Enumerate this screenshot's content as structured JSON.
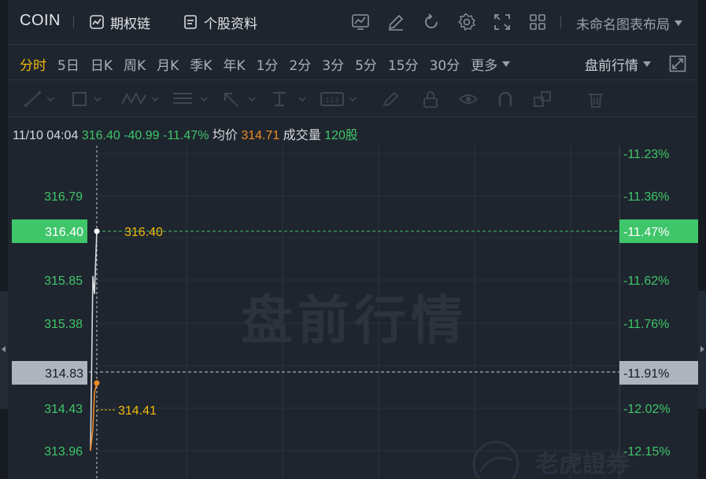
{
  "header": {
    "ticker": "COIN",
    "options_chain_label": "期权链",
    "profile_label": "个股资料",
    "layout_label": "未命名图表布局",
    "icons": [
      "indicator-icon",
      "edit-icon",
      "refresh-icon",
      "settings-icon",
      "fullscreen-icon",
      "grid-icon"
    ]
  },
  "periods": {
    "items": [
      "分时",
      "5日",
      "日K",
      "周K",
      "月K",
      "季K",
      "年K",
      "1分",
      "2分",
      "3分",
      "5分",
      "15分",
      "30分"
    ],
    "active": "分时",
    "more_label": "更多",
    "session_label": "盘前行情"
  },
  "info": {
    "time": "11/10 04:04",
    "price": "316.40",
    "change": "-40.99",
    "change_pct": "-11.47%",
    "avg_label": "均价",
    "avg_value": "314.71",
    "volume_label": "成交量",
    "volume_value": "120股"
  },
  "chart": {
    "watermark": "盘前行情",
    "brand": "老虎證券",
    "left_ticks": [
      "316.79",
      "315.85",
      "315.38",
      "314.43",
      "313.96"
    ],
    "right_ticks": [
      "-11.23%",
      "-11.36%",
      "-11.62%",
      "-11.76%",
      "-12.02%",
      "-12.15%"
    ],
    "price_tag": "316.40",
    "price_tag_pct": "-11.47%",
    "price_marker": "316.40",
    "cursor_tag": "314.83",
    "cursor_tag_pct": "-11.91%",
    "avg_marker": "314.41",
    "colors": {
      "up": "#3fc56a",
      "avg": "#f08a24",
      "marker": "#f0b90b",
      "bg": "#1f252e"
    }
  },
  "chart_data": {
    "type": "line",
    "series": [
      {
        "values": [
          313.96,
          315.9,
          315.7,
          316.4
        ]
      },
      {
        "values": [
          313.96,
          314.2,
          314.6,
          314.71
        ]
      }
    ],
    "ylim": [
      313.96,
      316.79
    ]
  }
}
